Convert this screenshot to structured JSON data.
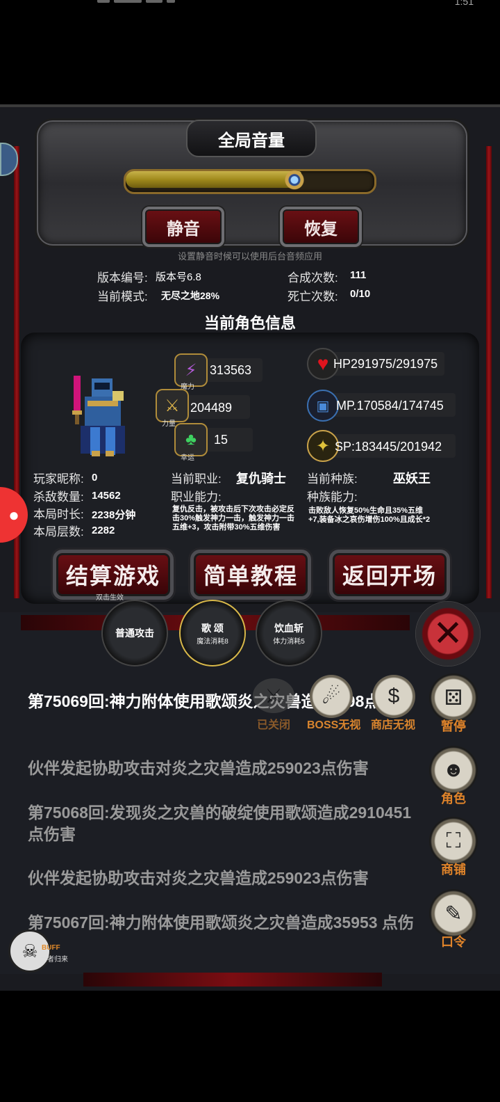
{
  "status_bar": {
    "time": "1:51"
  },
  "volume": {
    "title": "全局音量",
    "level_percent": 72,
    "mute_label": "静音",
    "restore_label": "恢复",
    "hint": "设置静音时候可以使用后台音频应用"
  },
  "game_info": {
    "version_label": "版本编号:",
    "version_value": "版本号6.8",
    "craft_label": "合成次数:",
    "craft_value": "111",
    "mode_label": "当前模式:",
    "mode_value": "无尽之地28%",
    "death_label": "死亡次数:",
    "death_value": "0/10"
  },
  "character": {
    "section_title": "当前角色信息",
    "magic_value": "313563",
    "magic_caption": "魔力",
    "strength_value": "204489",
    "strength_caption": "力量",
    "luck_value": "15",
    "luck_caption": "幸运",
    "hp": "HP291975/291975",
    "mp": "MP.170584/174745",
    "sp": "SP:183445/201942",
    "nickname_label": "玩家昵称:",
    "nickname_value": "0",
    "kills_label": "杀敌数量:",
    "kills_value": "14562",
    "duration_label": "本局时长:",
    "duration_value": "2238分钟",
    "floor_label": "本局层数:",
    "floor_value": "2282",
    "class_label": "当前职业:",
    "class_value": "复仇骑士",
    "class_ability_label": "职业能力:",
    "class_ability_text": "复仇反击，被攻击后下次攻击必定反击30%触发神力一击，触发神力一击五维+3，攻击附带30%五维伤害",
    "race_label": "当前种族:",
    "race_value": "巫妖王",
    "race_ability_label": "种族能力:",
    "race_ability_text": "击败敌人恢复50%生命且35%五维+7,装备冰之哀伤增伤100%且成长*2"
  },
  "actions": {
    "settle_label": "结算游戏",
    "settle_sub": "双击生效",
    "tutorial_label": "简单教程",
    "return_label": "返回开场"
  },
  "skills": [
    {
      "name": "普通攻击",
      "cost": ""
    },
    {
      "name": "歌 颂",
      "cost": "魔法消耗8"
    },
    {
      "name": "饮血斩",
      "cost": "体力消耗5"
    }
  ],
  "toggles": {
    "closed_label": "已关闭",
    "boss_label": "BOSS无视",
    "shop_label": "商店无视"
  },
  "side_menu": {
    "pause_label": "暂停",
    "role_label": "角色",
    "shop_label": "商铺",
    "code_label": "口令"
  },
  "log": [
    {
      "text": "第75069回:神力附体使用歌颂炎之灾兽造成3 98点伤害",
      "color": "#ffffff"
    },
    {
      "text": "伙伴发起协助攻击对炎之灾兽造成259023点伤害",
      "color": "#9a9a9a"
    },
    {
      "text": "第75068回:发现炎之灾兽的破绽使用歌颂造成2910451点伤害",
      "color": "#9a9a9a"
    },
    {
      "text": "伙伴发起协助攻击对炎之灾兽造成259023点伤害",
      "color": "#9a9a9a"
    },
    {
      "text": "第75067回:神力附体使用歌颂炎之灾兽造成35953 点伤害",
      "color": "#9a9a9a"
    }
  ],
  "buff": {
    "label": "BUFF",
    "sub": "亡者归来"
  }
}
